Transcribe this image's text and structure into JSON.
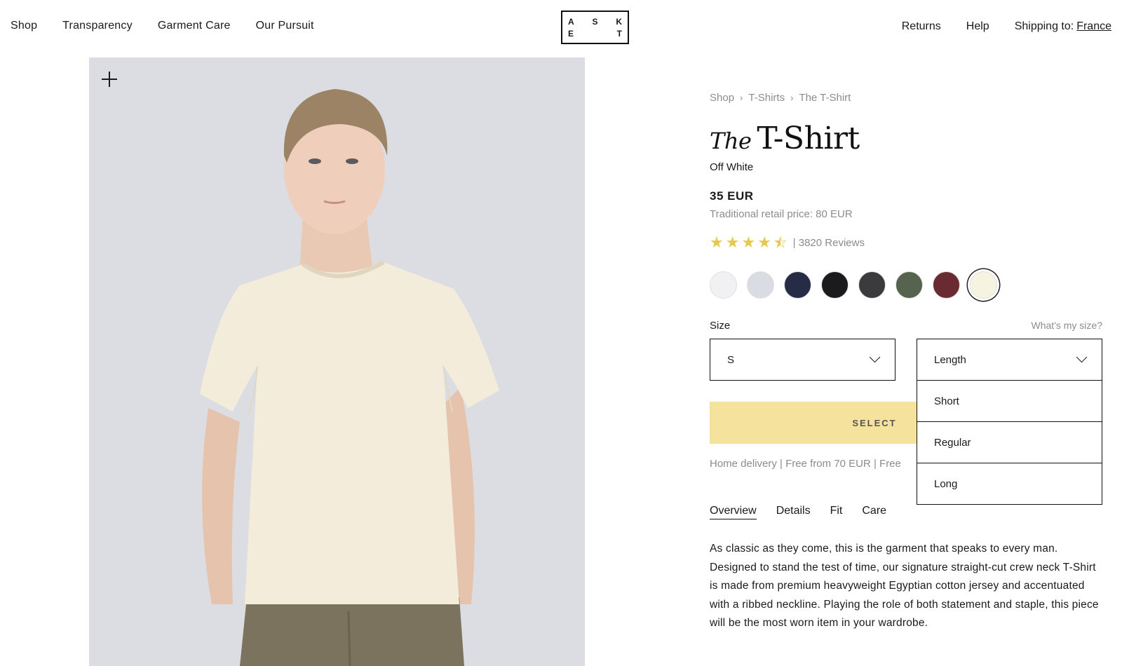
{
  "header": {
    "nav_left": [
      "Shop",
      "Transparency",
      "Garment Care",
      "Our Pursuit"
    ],
    "logo_letters": [
      "A",
      "S",
      "K",
      "E",
      "",
      "T"
    ],
    "nav_right": {
      "returns": "Returns",
      "help": "Help",
      "shipping_label": "Shipping to:",
      "shipping_country": "France"
    }
  },
  "breadcrumb": [
    "Shop",
    "T-Shirts",
    "The T-Shirt"
  ],
  "product": {
    "title_prefix": "The",
    "title": "T-Shirt",
    "color_name": "Off White",
    "price": "35 EUR",
    "retail_price": "Traditional retail price: 80 EUR",
    "rating": 4.5,
    "reviews": "| 3820 Reviews",
    "swatches": [
      "#f1f1f3",
      "#d9dce2",
      "#262c45",
      "#1b1b1d",
      "#3b3a3d",
      "#56644f",
      "#6a2a32",
      "#f7f3e1"
    ],
    "selected_swatch": 7
  },
  "size": {
    "label": "Size",
    "help": "What's my size?",
    "size_value": "S",
    "length_value": "Length",
    "length_options": [
      "Short",
      "Regular",
      "Long"
    ]
  },
  "cta": {
    "label": "SELECT"
  },
  "delivery": "Home delivery | Free from 70 EUR | Free",
  "tabs": [
    "Overview",
    "Details",
    "Fit",
    "Care"
  ],
  "description": "As classic as they come, this is the garment that speaks to every man. Designed to stand the test of time, our signature straight-cut crew neck T-Shirt is made from premium heavyweight Egyptian cotton jersey and accentuated with a ribbed neckline. Playing the role of both statement and staple, this piece will be the most worn item in your wardrobe."
}
